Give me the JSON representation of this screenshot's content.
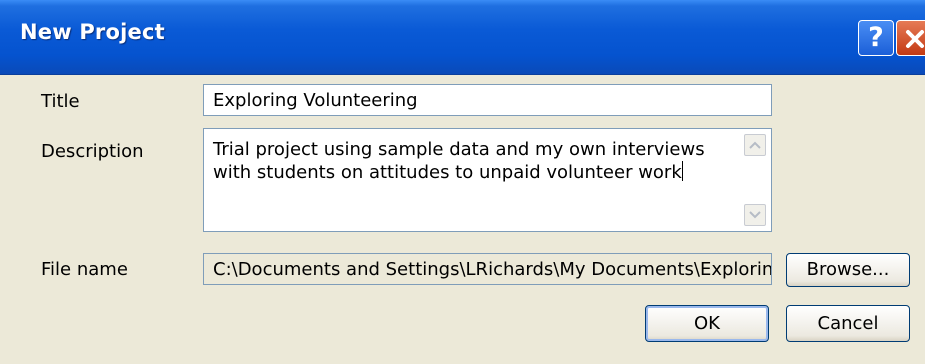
{
  "window": {
    "title": "New Project",
    "help_label": "?",
    "close_label": "close"
  },
  "form": {
    "title_label": "Title",
    "title_value": "Exploring Volunteering",
    "description_label": "Description",
    "description_value": "Trial project using sample data and my own interviews with students on attitudes to unpaid volunteer work",
    "filename_label": "File name",
    "filename_value": "C:\\Documents and Settings\\LRichards\\My Documents\\Exploring Vo"
  },
  "buttons": {
    "browse": "Browse...",
    "ok": "OK",
    "cancel": "Cancel"
  },
  "icons": {
    "help": "help-icon",
    "close": "close-icon",
    "scroll_up": "chevron-up-icon",
    "scroll_down": "chevron-down-icon"
  },
  "colors": {
    "titlebar": "#0553cf",
    "dialog_bg": "#ece9d8",
    "close_button": "#c33a14",
    "field_border": "#7f9db9"
  }
}
